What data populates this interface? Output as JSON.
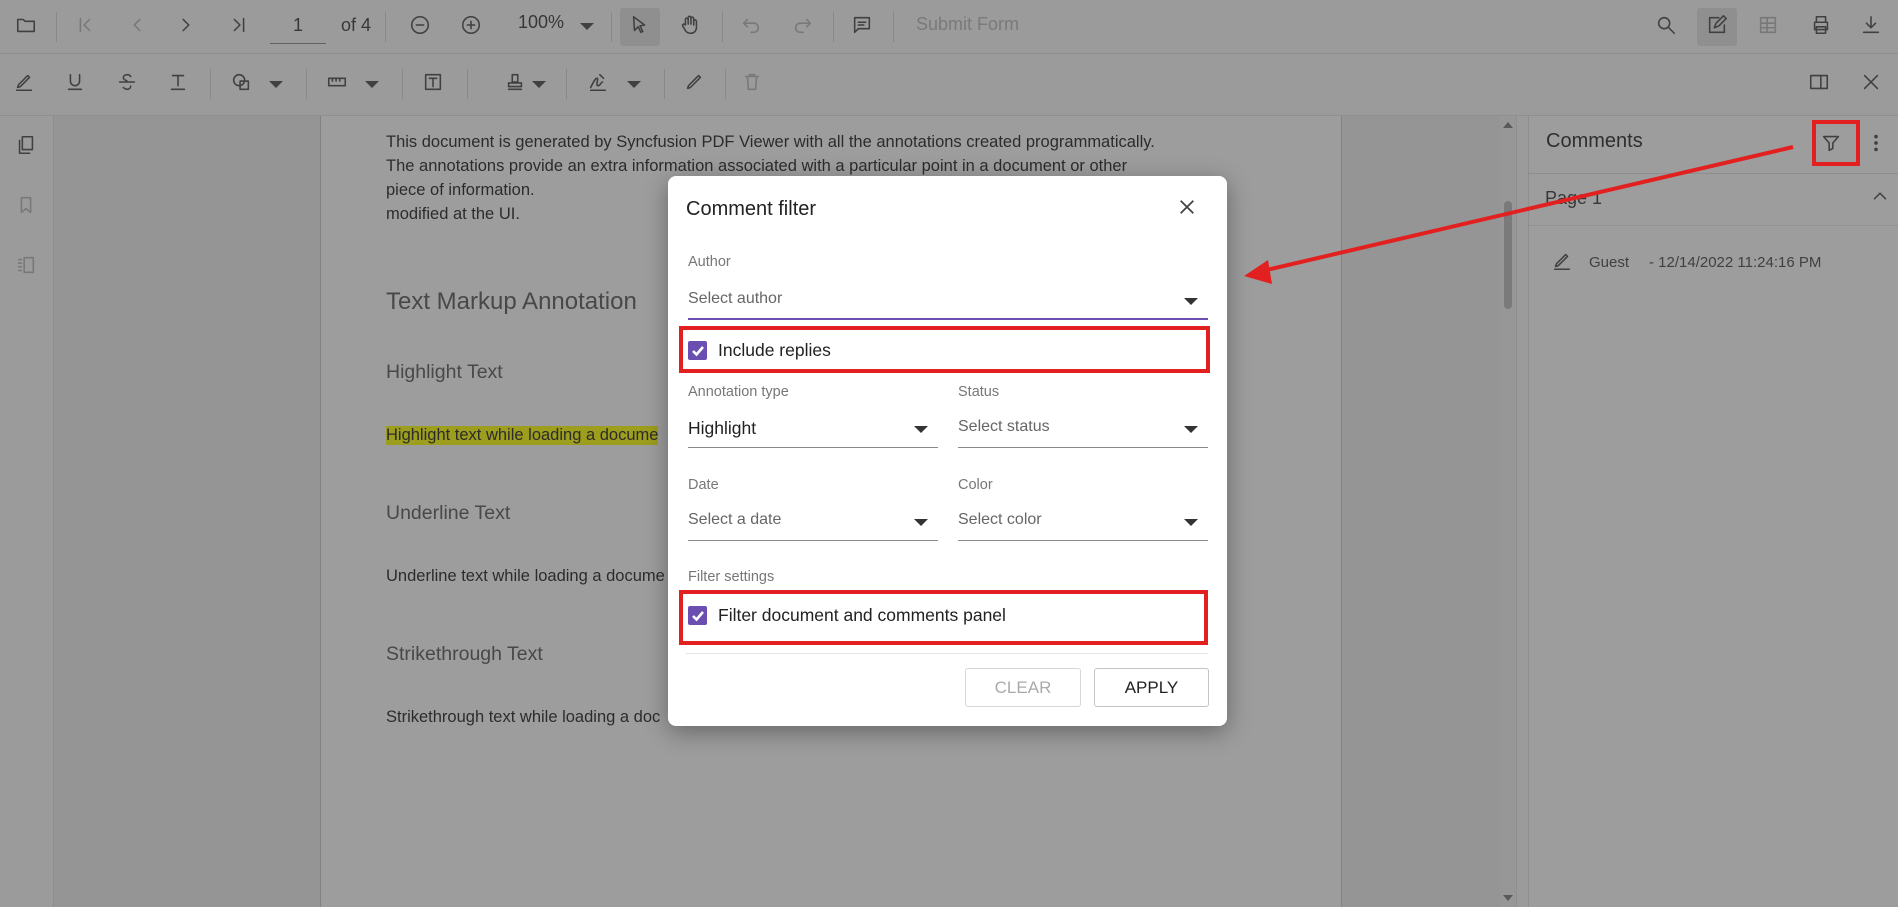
{
  "toolbar": {
    "page_number": "1",
    "page_count": "of 4",
    "zoom": "100%",
    "submit_form": "Submit Form"
  },
  "document": {
    "intro": "This document is generated by Syncfusion PDF Viewer with all the annotations created programmatically. The annotations provide an extra information associated with a particular point in a document or other piece of information.",
    "intro_last_line": "modified at the UI.",
    "section_title": "Text Markup Annotation",
    "highlight_heading": "Highlight Text",
    "highlight_body": "Highlight text while loading a docume",
    "underline_heading": "Underline Text",
    "underline_body": "Underline text while loading a docume",
    "strikethrough_heading": "Strikethrough Text",
    "strikethrough_body": "Strikethrough text while loading a doc"
  },
  "comments_panel": {
    "title": "Comments",
    "page_group": "Page 1",
    "comment": {
      "author": "Guest",
      "date": "- 12/14/2022 11:24:16 PM"
    }
  },
  "dialog": {
    "title": "Comment filter",
    "author_label": "Author",
    "author_placeholder": "Select author",
    "include_replies": "Include replies",
    "annotation_type_label": "Annotation type",
    "annotation_type_value": "Highlight",
    "status_label": "Status",
    "status_placeholder": "Select status",
    "date_label": "Date",
    "date_placeholder": "Select a date",
    "color_label": "Color",
    "color_placeholder": "Select color",
    "filter_settings_label": "Filter settings",
    "filter_panel": "Filter document and comments panel",
    "clear_button": "CLEAR",
    "apply_button": "APPLY"
  },
  "colors": {
    "accent": "#6a4fb0",
    "highlight": "#ffff00",
    "annotation_red": "#e32020"
  },
  "icons": [
    "folder-icon",
    "first-page-icon",
    "prev-page-icon",
    "next-page-icon",
    "last-page-icon",
    "zoom-out-icon",
    "zoom-in-icon",
    "chevron-down-icon",
    "select-pointer-icon",
    "pan-hand-icon",
    "undo-icon",
    "redo-icon",
    "comment-icon",
    "search-icon",
    "annotation-edit-icon",
    "form-fields-icon",
    "print-icon",
    "download-icon",
    "highlight-icon",
    "underline-icon",
    "strikethrough-icon",
    "shape-icon",
    "measure-icon",
    "free-text-icon",
    "stamp-icon",
    "signature-icon",
    "ink-icon",
    "delete-icon",
    "panel-toggle-icon",
    "close-icon",
    "thumbnails-icon",
    "bookmark-icon",
    "organize-pages-icon",
    "filter-icon",
    "more-vertical-icon",
    "pen-icon",
    "checkmark-icon"
  ]
}
